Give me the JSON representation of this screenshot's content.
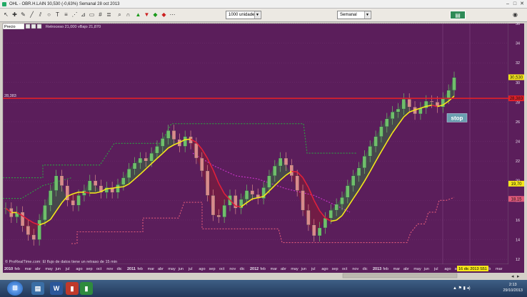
{
  "window": {
    "title": "OHL - OBR.H.LAIN   30,530 (-0,63%)   Semanal 28 oct 2013",
    "minimize_icon": "minimize-icon",
    "maximize_icon": "maximize-icon",
    "close_icon": "close-icon"
  },
  "toolbar": {
    "quantity_select": "1000 unidades",
    "period_select": "Semanal"
  },
  "chart_panel": {
    "label": "Precio",
    "legend_text": "Retroceso 21,000 vBajo 21,870",
    "stop_label": "stop",
    "footer_text": "© ProRealTime.com: El flujo de datos tiene un retraso de 15 min",
    "date_marker": "16 dic 2013 S51"
  },
  "price_axis": {
    "ticks": [
      "36",
      "34",
      "32",
      "30",
      "28",
      "26",
      "24",
      "22",
      "20",
      "18",
      "16",
      "14",
      "12"
    ],
    "current_price": "30,530",
    "red_line_price": "28,383",
    "yellow_line_price": "19,70",
    "lower_label": "18,15",
    "left_red_label": "28,383"
  },
  "time_axis": {
    "labels": [
      {
        "t": "2010",
        "bold": true
      },
      {
        "t": "feb"
      },
      {
        "t": "mar"
      },
      {
        "t": "abr"
      },
      {
        "t": "may"
      },
      {
        "t": "jun"
      },
      {
        "t": "jul"
      },
      {
        "t": "ago"
      },
      {
        "t": "sep"
      },
      {
        "t": "oct"
      },
      {
        "t": "nov"
      },
      {
        "t": "dic"
      },
      {
        "t": "2011",
        "bold": true
      },
      {
        "t": "feb"
      },
      {
        "t": "mar"
      },
      {
        "t": "abr"
      },
      {
        "t": "may"
      },
      {
        "t": "jun"
      },
      {
        "t": "jul"
      },
      {
        "t": "ago"
      },
      {
        "t": "sep"
      },
      {
        "t": "oct"
      },
      {
        "t": "nov"
      },
      {
        "t": "dic"
      },
      {
        "t": "2012",
        "bold": true
      },
      {
        "t": "feb"
      },
      {
        "t": "mar"
      },
      {
        "t": "abr"
      },
      {
        "t": "may"
      },
      {
        "t": "jun"
      },
      {
        "t": "jul"
      },
      {
        "t": "ago"
      },
      {
        "t": "sep"
      },
      {
        "t": "oct"
      },
      {
        "t": "nov"
      },
      {
        "t": "dic"
      },
      {
        "t": "2013",
        "bold": true
      },
      {
        "t": "feb"
      },
      {
        "t": "mar"
      },
      {
        "t": "abr"
      },
      {
        "t": "may"
      },
      {
        "t": "jun"
      },
      {
        "t": "jul"
      },
      {
        "t": "ago"
      },
      {
        "t": "sep"
      },
      {
        "t": "oct"
      },
      {
        "t": "nov"
      },
      {
        "t": "feb"
      },
      {
        "t": "mar"
      }
    ]
  },
  "taskbar": {
    "apps": [
      "start-orb-icon",
      "file-explorer-icon",
      "word-icon",
      "prorealtime-icon",
      "app-icon"
    ],
    "word_letter": "W",
    "clock_time": "2:13",
    "clock_date": "29/10/2013"
  },
  "colors": {
    "chart_bg": "#5b1e5b",
    "up_candle": "#6fbf6a",
    "down_candle": "#d98b8b",
    "ma_up": "#f5e71b",
    "ma_down": "#e0213b",
    "stop_dotted_green": "#2ea043",
    "stop_dotted_red": "#e05a7a",
    "stop_dotted_magenta": "#cc33cc",
    "resistance": "#e0202a"
  },
  "chart_data": {
    "type": "line",
    "ylim": [
      11.5,
      36
    ],
    "series": [
      {
        "values": [
          17.2,
          16.3,
          16.8,
          15.4,
          14.5,
          14.0,
          16.0,
          17.5,
          19.0,
          20.5,
          19.5,
          18.0,
          17.5,
          18.5,
          19.0,
          20.0,
          19.5,
          18.8,
          19.3,
          18.8,
          19.6,
          20.3,
          21.2,
          21.8,
          22.3,
          22.0,
          22.8,
          23.5,
          24.3,
          25.1,
          24.2,
          23.5,
          24.5,
          23.8,
          22.3,
          21.0,
          18.5,
          16.5,
          16.3,
          17.5,
          18.5,
          17.2,
          18.1,
          19.0,
          18.6,
          18.2,
          19.3,
          20.5,
          21.5,
          22.3,
          21.6,
          20.5,
          19.0,
          17.0,
          15.5,
          14.4,
          15.2,
          16.2,
          17.0,
          17.6,
          18.3,
          19.5,
          20.5,
          21.3,
          22.5,
          23.5,
          24.5,
          25.5,
          26.3,
          27.0,
          27.3,
          28.3,
          27.5,
          26.8,
          27.4,
          28.1,
          28.0,
          27.5,
          28.4,
          29.2,
          30.5
        ]
      }
    ]
  }
}
